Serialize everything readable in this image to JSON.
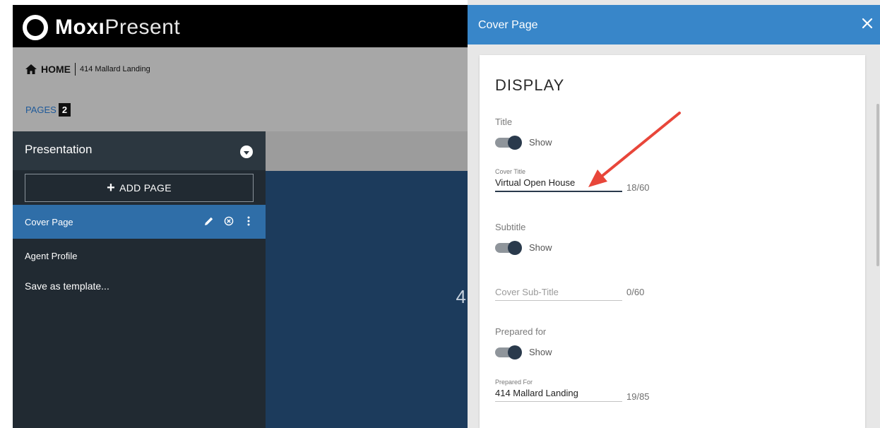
{
  "app": {
    "logo_bold": "Moxı",
    "logo_light": "Present"
  },
  "breadcrumb": {
    "home": "HOME",
    "current": "414 Mallard Landing"
  },
  "pages": {
    "label": "PAGES",
    "count": "2"
  },
  "sidebar": {
    "title": "Presentation",
    "add_page": "ADD PAGE",
    "items": [
      {
        "label": "Cover Page",
        "active": true
      },
      {
        "label": "Agent Profile",
        "active": false
      },
      {
        "label": "Save as template...",
        "active": false
      }
    ]
  },
  "stage": {
    "partial_text": "4"
  },
  "panel": {
    "title": "Cover Page",
    "section": "DISPLAY",
    "title_group": {
      "label": "Title",
      "toggle": "Show",
      "toggle_on": true,
      "field_label": "Cover Title",
      "value": "Virtual Open House",
      "count": "18/60"
    },
    "subtitle_group": {
      "label": "Subtitle",
      "toggle": "Show",
      "toggle_on": true,
      "placeholder": "Cover Sub-Title",
      "count": "0/60"
    },
    "prepared_group": {
      "label": "Prepared for",
      "toggle": "Show",
      "toggle_on": true,
      "field_label": "Prepared For",
      "value": "414 Mallard Landing",
      "count": "19/85"
    }
  },
  "colors": {
    "panel_header": "#3886c9",
    "sidebar_bg": "#212a32",
    "active_item": "#2f6ea8",
    "annotation_arrow": "#e8463a"
  }
}
